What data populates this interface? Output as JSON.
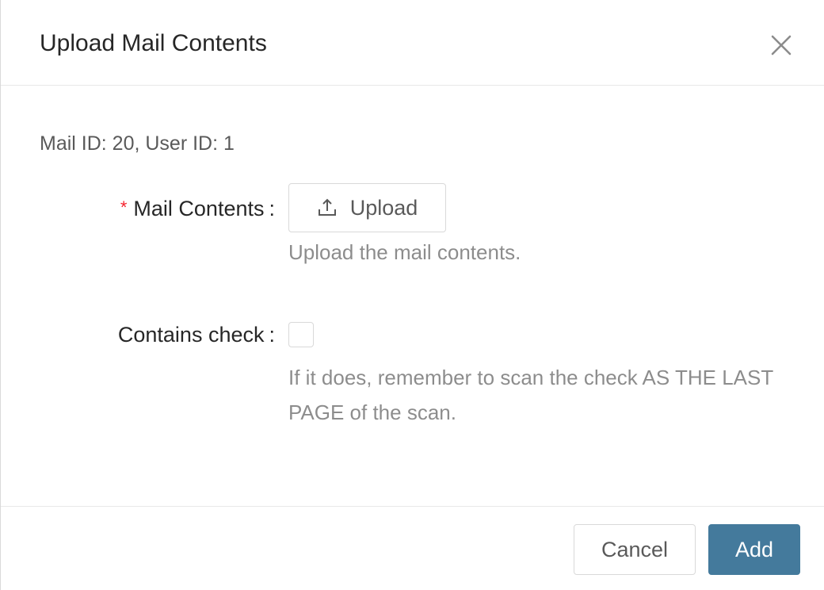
{
  "dialog": {
    "title": "Upload Mail Contents",
    "close_icon": "close-icon"
  },
  "info": {
    "text": "Mail ID: 20, User ID: 1"
  },
  "form": {
    "mail_contents": {
      "required_mark": "*",
      "label": "Mail Contents",
      "colon": ":",
      "upload_button_label": "Upload",
      "upload_icon": "upload-icon",
      "help": "Upload the mail contents."
    },
    "contains_check": {
      "label": "Contains check",
      "colon": ":",
      "checked": false,
      "help": "If it does, remember to scan the check AS THE LAST PAGE of the scan."
    }
  },
  "footer": {
    "cancel_label": "Cancel",
    "add_label": "Add"
  },
  "colors": {
    "primary": "#447a9c",
    "required": "#f5222d"
  }
}
